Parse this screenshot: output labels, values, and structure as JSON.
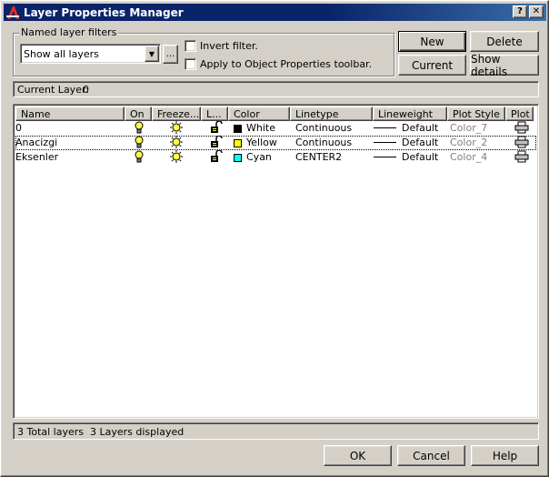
{
  "window": {
    "title": "Layer Properties Manager",
    "help_glyph": "?",
    "close_glyph": "✕"
  },
  "filters": {
    "group_label": "Named layer filters",
    "selected": "Show all layers",
    "ellipsis": "...",
    "invert_label": "Invert filter.",
    "apply_label": "Apply to Object Properties toolbar."
  },
  "buttons": {
    "new": "New",
    "delete": "Delete",
    "current": "Current",
    "show_details": "Show details",
    "ok": "OK",
    "cancel": "Cancel",
    "help": "Help"
  },
  "current_layer": {
    "label": "Current Layer:",
    "value": "0"
  },
  "columns": [
    "Name",
    "On",
    "Freeze...",
    "L...",
    "Color",
    "Linetype",
    "Lineweight",
    "Plot Style",
    "Plot"
  ],
  "layers": [
    {
      "name": "0",
      "color_name": "White",
      "color_hex": "#000000",
      "linetype": "Continuous",
      "lineweight": "Default",
      "plot_style": "Color_7"
    },
    {
      "name": "Anacizgi",
      "color_name": "Yellow",
      "color_hex": "#ffff00",
      "linetype": "Continuous",
      "lineweight": "Default",
      "plot_style": "Color_2"
    },
    {
      "name": "Eksenler",
      "color_name": "Cyan",
      "color_hex": "#00ffff",
      "linetype": "CENTER2",
      "lineweight": "Default",
      "plot_style": "Color_4"
    }
  ],
  "status": {
    "total": "3 Total layers",
    "displayed": "3 Layers displayed"
  },
  "icons": {
    "on": "lightbulb-icon",
    "freeze": "sun-icon",
    "lock": "unlocked-padlock-icon",
    "plot": "printer-icon"
  },
  "colors": {
    "title_bar": "#0a246a",
    "face": "#d4d0c8"
  }
}
